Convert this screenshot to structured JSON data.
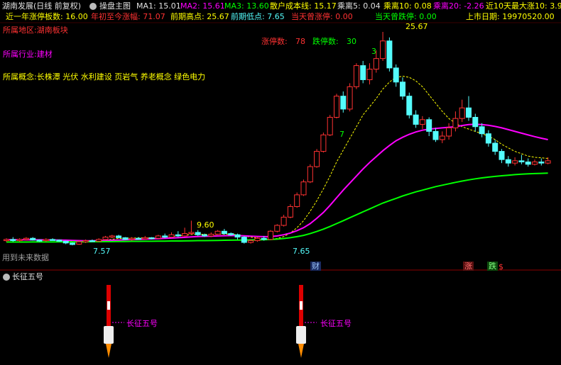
{
  "header": {
    "title": "湖南发展(日线 前复权)",
    "main_chart_label": "操盘主图",
    "ma1": "MA1: 15.01",
    "ma2": "MA2: 15.61",
    "ma3": "MA3: 13.60",
    "cost": "散户成本线: 15.17",
    "dev5": "乘离5: 0.04",
    "dev10": "乘离10: 0.08",
    "dev20": "乘离20: -2.26",
    "max10": "近10天最大涨10: 3.9"
  },
  "info_row": {
    "limit_up_count": "近一年涨停板数: 16.00",
    "ytd_gain": "年初至今涨幅: 71.07",
    "period_high": "前期高点: 25.67",
    "period_low": "前期低点: 7.65",
    "today_limit_up": "当天曾涨停: 0.00",
    "today_limit_down": "当天曾跌停: 0.00",
    "listing_date": "上市日期: 19970520.00"
  },
  "overlay": {
    "region": "所属地区:湖南板块",
    "industry": "所属行业:建材",
    "concepts": "所属概念:长株潭 光伏 水利建设 页岩气 养老概念 绿色电力",
    "up_count_label": "涨停数:",
    "up_count_value": "78",
    "down_count_label": "跌停数:",
    "down_count_value": "30",
    "future_data_note": "用到未来数据"
  },
  "price_labels": {
    "high": "25.67",
    "mid": "9.60",
    "low1": "7.57",
    "low2": "7.65",
    "count3": "3",
    "count7": "7"
  },
  "markers": {
    "cai": "财",
    "zhang": "涨",
    "die": "跌",
    "dollar": "$"
  },
  "sub_chart": {
    "title": "长征五号",
    "signal_label_1": "长征五号",
    "signal_label_2": "长征五号"
  },
  "colors": {
    "up": "#ff3232",
    "down": "#54fcfc",
    "ma_magenta": "#ff00ff",
    "ma_green": "#00ff00",
    "ma_yellow": "#ffff00",
    "label_yellow": "#ffff00",
    "label_red": "#ff3232",
    "label_magenta": "#ff00ff",
    "label_green": "#00ff00",
    "label_cyan": "#54fcfc"
  },
  "chart_data": {
    "type": "candlestick",
    "y_axis": "price",
    "candles": [
      [
        7.9,
        8.0,
        8.1,
        7.8
      ],
      [
        8.0,
        7.9,
        8.2,
        7.8
      ],
      [
        7.9,
        8.0,
        8.1,
        7.8
      ],
      [
        8.0,
        8.1,
        8.2,
        7.9
      ],
      [
        8.1,
        7.95,
        8.2,
        7.9
      ],
      [
        7.95,
        7.9,
        8.0,
        7.8
      ],
      [
        7.9,
        8.0,
        8.1,
        7.8
      ],
      [
        8.0,
        7.95,
        8.1,
        7.9
      ],
      [
        7.95,
        7.85,
        8.0,
        7.8
      ],
      [
        7.85,
        7.7,
        7.9,
        7.6
      ],
      [
        7.7,
        7.57,
        7.75,
        7.5
      ],
      [
        7.6,
        7.8,
        7.9,
        7.55
      ],
      [
        7.8,
        7.9,
        8.0,
        7.7
      ],
      [
        7.9,
        7.85,
        8.0,
        7.8
      ],
      [
        7.85,
        8.0,
        8.1,
        7.8
      ],
      [
        8.0,
        8.2,
        8.3,
        7.95
      ],
      [
        8.2,
        8.3,
        8.4,
        8.1
      ],
      [
        8.3,
        8.15,
        8.4,
        8.1
      ],
      [
        8.15,
        8.0,
        8.2,
        7.95
      ],
      [
        8.0,
        8.1,
        8.2,
        7.9
      ],
      [
        8.1,
        8.05,
        8.2,
        8.0
      ],
      [
        8.05,
        8.15,
        8.3,
        8.0
      ],
      [
        8.15,
        8.1,
        8.2,
        8.0
      ],
      [
        8.1,
        8.3,
        8.4,
        8.05
      ],
      [
        8.3,
        8.2,
        8.5,
        8.1
      ],
      [
        8.2,
        8.4,
        8.6,
        8.15
      ],
      [
        8.4,
        8.3,
        8.7,
        8.2
      ],
      [
        8.3,
        8.5,
        9.0,
        8.25
      ],
      [
        8.5,
        8.6,
        9.6,
        8.4
      ],
      [
        8.6,
        8.4,
        8.8,
        8.3
      ],
      [
        8.4,
        8.3,
        8.5,
        8.2
      ],
      [
        8.3,
        8.45,
        8.6,
        8.2
      ],
      [
        8.45,
        8.7,
        8.8,
        8.4
      ],
      [
        8.7,
        8.5,
        8.9,
        8.4
      ],
      [
        8.5,
        8.4,
        8.6,
        8.3
      ],
      [
        8.4,
        8.2,
        8.5,
        8.0
      ],
      [
        8.2,
        7.75,
        8.3,
        7.65
      ],
      [
        7.75,
        7.9,
        8.0,
        7.65
      ],
      [
        7.9,
        8.1,
        8.2,
        7.8
      ],
      [
        8.1,
        8.0,
        8.3,
        7.9
      ],
      [
        8.0,
        8.7,
        8.8,
        7.95
      ],
      [
        8.7,
        9.2,
        9.3,
        8.6
      ],
      [
        9.2,
        9.9,
        10.1,
        9.1
      ],
      [
        9.9,
        10.8,
        11.0,
        9.8
      ],
      [
        10.8,
        11.8,
        12.0,
        10.7
      ],
      [
        11.8,
        12.9,
        13.1,
        11.7
      ],
      [
        12.9,
        14.2,
        14.4,
        12.8
      ],
      [
        14.2,
        15.5,
        15.7,
        14.1
      ],
      [
        15.5,
        16.9,
        17.1,
        15.4
      ],
      [
        16.9,
        18.4,
        18.6,
        16.8
      ],
      [
        18.4,
        20.2,
        20.4,
        18.3
      ],
      [
        20.2,
        19.1,
        20.6,
        18.8
      ],
      [
        19.1,
        21.0,
        21.3,
        18.9
      ],
      [
        21.0,
        22.8,
        23.0,
        20.8
      ],
      [
        22.8,
        21.6,
        23.2,
        21.3
      ],
      [
        21.6,
        22.5,
        23.0,
        21.2
      ],
      [
        22.5,
        23.4,
        24.1,
        22.2
      ],
      [
        23.4,
        24.9,
        25.67,
        23.2
      ],
      [
        24.9,
        22.6,
        25.2,
        22.3
      ],
      [
        22.6,
        21.4,
        22.9,
        21.0
      ],
      [
        21.4,
        20.2,
        21.8,
        19.9
      ],
      [
        20.2,
        18.6,
        20.5,
        18.3
      ],
      [
        18.6,
        17.8,
        19.0,
        17.5
      ],
      [
        17.8,
        18.2,
        18.5,
        17.4
      ],
      [
        18.2,
        17.2,
        18.4,
        16.8
      ],
      [
        17.2,
        16.5,
        17.5,
        16.3
      ],
      [
        16.5,
        16.8,
        17.2,
        16.2
      ],
      [
        16.8,
        17.5,
        17.9,
        16.5
      ],
      [
        17.5,
        18.3,
        18.9,
        17.2
      ],
      [
        18.3,
        19.2,
        19.9,
        18.0
      ],
      [
        19.2,
        18.4,
        20.2,
        18.1
      ],
      [
        18.4,
        17.6,
        18.7,
        17.2
      ],
      [
        17.6,
        17.0,
        17.9,
        16.7
      ],
      [
        17.0,
        16.2,
        17.3,
        15.9
      ],
      [
        16.2,
        15.5,
        16.5,
        15.2
      ],
      [
        15.5,
        14.8,
        15.7,
        14.5
      ],
      [
        14.8,
        14.5,
        15.1,
        14.2
      ],
      [
        14.5,
        14.7,
        15.0,
        14.3
      ],
      [
        14.7,
        14.6,
        15.2,
        14.4
      ],
      [
        14.6,
        14.4,
        14.9,
        14.2
      ],
      [
        14.4,
        14.6,
        14.8,
        14.3
      ],
      [
        14.6,
        14.5,
        14.9,
        14.3
      ],
      [
        14.5,
        14.7,
        15.0,
        14.4
      ]
    ],
    "ma_series": [
      {
        "name": "MA1",
        "color": "#ffff00",
        "style": "dashed",
        "values": [
          7.95,
          7.95,
          7.96,
          7.97,
          7.97,
          7.96,
          7.96,
          7.96,
          7.94,
          7.9,
          7.83,
          7.8,
          7.8,
          7.82,
          7.86,
          7.94,
          8.02,
          8.08,
          8.1,
          8.12,
          8.13,
          8.14,
          8.14,
          8.16,
          8.2,
          8.26,
          8.3,
          8.36,
          8.42,
          8.45,
          8.44,
          8.42,
          8.44,
          8.46,
          8.45,
          8.4,
          8.3,
          8.2,
          8.12,
          8.05,
          8.02,
          8.08,
          8.25,
          8.55,
          9.0,
          9.6,
          10.4,
          11.3,
          12.3,
          13.4,
          14.6,
          15.6,
          16.6,
          17.6,
          18.6,
          19.3,
          20.0,
          20.8,
          21.4,
          21.8,
          21.9,
          21.8,
          21.5,
          21.0,
          20.3,
          19.6,
          18.9,
          18.3,
          17.9,
          17.6,
          17.4,
          17.2,
          17.0,
          16.8,
          16.5,
          16.1,
          15.8,
          15.5,
          15.3,
          15.1,
          15.0,
          14.95,
          14.9
        ]
      },
      {
        "name": "MA2",
        "color": "#ff00ff",
        "style": "solid",
        "values": [
          7.98,
          7.98,
          7.98,
          7.97,
          7.97,
          7.97,
          7.96,
          7.96,
          7.95,
          7.94,
          7.92,
          7.9,
          7.89,
          7.89,
          7.9,
          7.91,
          7.93,
          7.95,
          7.97,
          7.99,
          8.01,
          8.03,
          8.05,
          8.07,
          8.1,
          8.12,
          8.15,
          8.18,
          8.22,
          8.25,
          8.27,
          8.28,
          8.3,
          8.32,
          8.33,
          8.33,
          8.31,
          8.28,
          8.26,
          8.24,
          8.25,
          8.3,
          8.4,
          8.55,
          8.75,
          9.0,
          9.35,
          9.8,
          10.3,
          10.9,
          11.55,
          12.2,
          12.8,
          13.4,
          14.0,
          14.55,
          15.05,
          15.55,
          16.0,
          16.4,
          16.7,
          16.95,
          17.15,
          17.3,
          17.4,
          17.45,
          17.5,
          17.55,
          17.6,
          17.7,
          17.78,
          17.8,
          17.78,
          17.72,
          17.62,
          17.5,
          17.35,
          17.2,
          17.05,
          16.9,
          16.75,
          16.62,
          16.5
        ]
      },
      {
        "name": "MA3",
        "color": "#00ff00",
        "style": "solid",
        "values": [
          7.78,
          7.78,
          7.78,
          7.78,
          7.79,
          7.79,
          7.79,
          7.79,
          7.8,
          7.8,
          7.8,
          7.8,
          7.8,
          7.81,
          7.81,
          7.82,
          7.82,
          7.83,
          7.83,
          7.84,
          7.84,
          7.85,
          7.85,
          7.86,
          7.86,
          7.87,
          7.87,
          7.88,
          7.89,
          7.9,
          7.9,
          7.91,
          7.92,
          7.93,
          7.94,
          7.95,
          7.95,
          7.96,
          7.97,
          7.98,
          8.0,
          8.03,
          8.08,
          8.15,
          8.24,
          8.35,
          8.5,
          8.68,
          8.88,
          9.1,
          9.35,
          9.6,
          9.85,
          10.1,
          10.35,
          10.6,
          10.85,
          11.1,
          11.3,
          11.5,
          11.7,
          11.88,
          12.05,
          12.2,
          12.35,
          12.5,
          12.62,
          12.74,
          12.86,
          12.97,
          13.07,
          13.16,
          13.24,
          13.31,
          13.37,
          13.42,
          13.47,
          13.52,
          13.56,
          13.59,
          13.61,
          13.63,
          13.65
        ]
      }
    ]
  }
}
